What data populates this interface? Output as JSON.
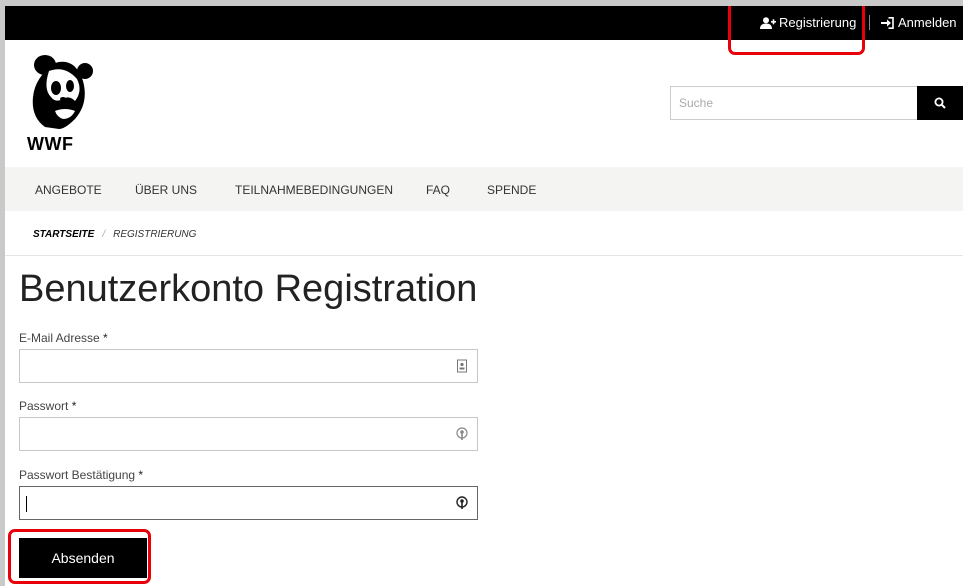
{
  "topbar": {
    "register_label": "Registrierung",
    "login_label": "Anmelden"
  },
  "header": {
    "logo_text": "WWF",
    "search_placeholder": "Suche"
  },
  "nav": {
    "items": [
      {
        "label": "ANGEBOTE"
      },
      {
        "label": "ÜBER UNS"
      },
      {
        "label": "TEILNAHMEBEDINGUNGEN"
      },
      {
        "label": "FAQ"
      },
      {
        "label": "SPENDE"
      }
    ]
  },
  "breadcrumb": {
    "home": "STARTSEITE",
    "separator": "/",
    "current": "REGISTRIERUNG"
  },
  "page": {
    "title": "Benutzerkonto Registration"
  },
  "form": {
    "email": {
      "label": "E-Mail Adresse",
      "required": "*",
      "value": ""
    },
    "password": {
      "label": "Passwort",
      "required": "*",
      "value": ""
    },
    "password_confirm": {
      "label": "Passwort Bestätigung",
      "required": "*",
      "value": ""
    },
    "submit_label": "Absenden"
  },
  "icons": {
    "register": "user-plus-icon",
    "login": "sign-in-icon",
    "search": "search-icon",
    "email_field": "contact-card-icon",
    "password_field": "key-icon",
    "password_confirm_field": "key-icon"
  },
  "colors": {
    "highlight": "#e8000a",
    "topbar": "#000000",
    "nav_background": "#f4f4f2"
  }
}
